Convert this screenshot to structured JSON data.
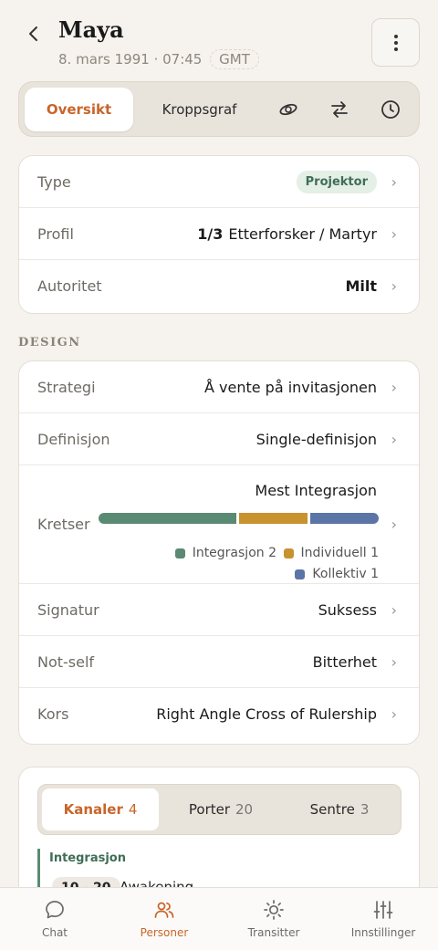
{
  "header": {
    "name": "Maya",
    "birth": "8. mars 1991 · 07:45",
    "timezone": "GMT"
  },
  "tabs": {
    "overview": "Oversikt",
    "bodygraph": "Kroppsgraf"
  },
  "summary": {
    "type_label": "Type",
    "type_value": "Projektor",
    "profile_label": "Profil",
    "profile_num": "1/3",
    "profile_value": "Etterforsker / Martyr",
    "authority_label": "Autoritet",
    "authority_value": "Milt"
  },
  "design_section": "DESIGN",
  "design": {
    "strategy_label": "Strategi",
    "strategy_value": "Å vente på invitasjonen",
    "definition_label": "Definisjon",
    "definition_value": "Single-definisjon",
    "circuits_label": "Kretser",
    "circuits_title": "Mest Integrasjon",
    "circuits": [
      {
        "name": "Integrasjon 2",
        "value": 2,
        "color": "#5a8a73"
      },
      {
        "name": "Individuell 1",
        "value": 1,
        "color": "#c8922e"
      },
      {
        "name": "Kollektiv 1",
        "value": 1,
        "color": "#5b75a6"
      }
    ],
    "signature_label": "Signatur",
    "signature_value": "Suksess",
    "notself_label": "Not-self",
    "notself_value": "Bitterhet",
    "cross_label": "Kors",
    "cross_value": "Right Angle Cross of Rulership"
  },
  "details": {
    "channels_label": "Kanaler",
    "channels_count": "4",
    "gates_label": "Porter",
    "gates_count": "20",
    "centers_label": "Sentre",
    "centers_count": "3",
    "group_label": "Integrasjon",
    "first_channel_num": "10 - 20",
    "first_channel_name": "Awakening"
  },
  "nav": {
    "chat": "Chat",
    "people": "Personer",
    "transits": "Transitter",
    "settings": "Innstillinger"
  },
  "colors": {
    "accent": "#c8652b",
    "integration": "#5a8a73",
    "individual": "#c8922e",
    "collective": "#5b75a6"
  }
}
